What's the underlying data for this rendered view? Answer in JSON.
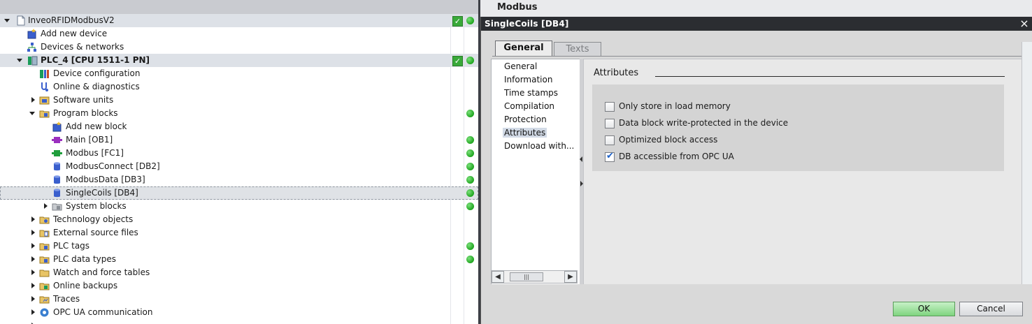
{
  "tree": {
    "rows": [
      {
        "label": "InveoRFIDModbusV2",
        "bold": false,
        "check": true,
        "dot": true
      },
      {
        "label": "Add new device",
        "bold": false,
        "check": false,
        "dot": false
      },
      {
        "label": "Devices & networks",
        "bold": false,
        "check": false,
        "dot": false
      },
      {
        "label": "PLC_4 [CPU 1511-1 PN]",
        "bold": true,
        "check": true,
        "dot": true
      },
      {
        "label": "Device configuration",
        "bold": false,
        "check": false,
        "dot": false
      },
      {
        "label": "Online & diagnostics",
        "bold": false,
        "check": false,
        "dot": false
      },
      {
        "label": "Software units",
        "bold": false,
        "check": false,
        "dot": false
      },
      {
        "label": "Program blocks",
        "bold": false,
        "check": false,
        "dot": true
      },
      {
        "label": "Add new block",
        "bold": false,
        "check": false,
        "dot": false
      },
      {
        "label": "Main [OB1]",
        "bold": false,
        "check": false,
        "dot": true
      },
      {
        "label": "Modbus [FC1]",
        "bold": false,
        "check": false,
        "dot": true
      },
      {
        "label": "ModbusConnect [DB2]",
        "bold": false,
        "check": false,
        "dot": true
      },
      {
        "label": "ModbusData [DB3]",
        "bold": false,
        "check": false,
        "dot": true
      },
      {
        "label": "SingleCoils [DB4]",
        "bold": false,
        "check": false,
        "dot": true
      },
      {
        "label": "System blocks",
        "bold": false,
        "check": false,
        "dot": true
      },
      {
        "label": "Technology objects",
        "bold": false,
        "check": false,
        "dot": false
      },
      {
        "label": "External source files",
        "bold": false,
        "check": false,
        "dot": false
      },
      {
        "label": "PLC tags",
        "bold": false,
        "check": false,
        "dot": true
      },
      {
        "label": "PLC data types",
        "bold": false,
        "check": false,
        "dot": true
      },
      {
        "label": "Watch and force tables",
        "bold": false,
        "check": false,
        "dot": false
      },
      {
        "label": "Online backups",
        "bold": false,
        "check": false,
        "dot": false
      },
      {
        "label": "Traces",
        "bold": false,
        "check": false,
        "dot": false
      },
      {
        "label": "OPC UA communication",
        "bold": false,
        "check": false,
        "dot": false
      }
    ]
  },
  "editor": {
    "title": "Modbus"
  },
  "dialog": {
    "title": "SingleCoils [DB4]",
    "close_icon": "×",
    "tabs": [
      {
        "label": "General",
        "active": true
      },
      {
        "label": "Texts",
        "active": false
      }
    ],
    "nav_items": [
      {
        "label": "General",
        "selected": false
      },
      {
        "label": "Information",
        "selected": false
      },
      {
        "label": "Time stamps",
        "selected": false
      },
      {
        "label": "Compilation",
        "selected": false
      },
      {
        "label": "Protection",
        "selected": false
      },
      {
        "label": "Attributes",
        "selected": true
      },
      {
        "label": "Download with...",
        "selected": false
      }
    ],
    "section_title": "Attributes",
    "checkboxes": [
      {
        "label": "Only store in load memory",
        "checked": false
      },
      {
        "label": "Data block write-protected in the device",
        "checked": false
      },
      {
        "label": "Optimized block access",
        "checked": false
      },
      {
        "label": "DB accessible from OPC UA",
        "checked": true
      }
    ],
    "ok_label": "OK",
    "cancel_label": "Cancel"
  }
}
